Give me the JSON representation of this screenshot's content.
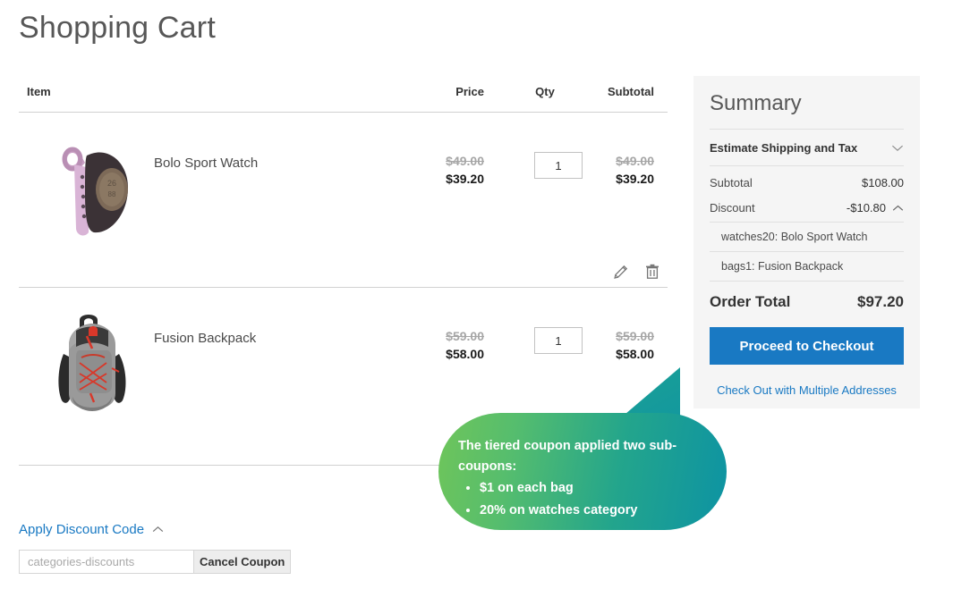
{
  "page": {
    "title": "Shopping Cart"
  },
  "cart": {
    "headers": {
      "item": "Item",
      "price": "Price",
      "qty": "Qty",
      "subtotal": "Subtotal"
    },
    "rows": [
      {
        "name": "Bolo Sport Watch",
        "image_alt": "bolo-sport-watch-image",
        "price_old": "$49.00",
        "price_new": "$39.20",
        "qty": "1",
        "subtotal_old": "$49.00",
        "subtotal_new": "$39.20",
        "edit_label": "edit-item",
        "remove_label": "remove-item"
      },
      {
        "name": "Fusion Backpack",
        "image_alt": "fusion-backpack-image",
        "price_old": "$59.00",
        "price_new": "$58.00",
        "qty": "1",
        "subtotal_old": "$59.00",
        "subtotal_new": "$58.00"
      }
    ]
  },
  "discount": {
    "toggle_label": "Apply Discount Code",
    "input_value": "",
    "input_placeholder": "categories-discounts",
    "button_label": "Cancel Coupon"
  },
  "summary": {
    "title": "Summary",
    "estimate_label": "Estimate Shipping and Tax",
    "subtotal_label": "Subtotal",
    "subtotal_value": "$108.00",
    "discount_label": "Discount",
    "discount_value": "-$10.80",
    "coupon_details": [
      "watches20: Bolo Sport Watch",
      "bags1: Fusion Backpack"
    ],
    "order_total_label": "Order Total",
    "order_total_value": "$97.20",
    "checkout_label": "Proceed to Checkout",
    "multi_address_label": "Check Out with Multiple Addresses"
  },
  "callout": {
    "heading": "The tiered coupon applied two sub-coupons:",
    "items": [
      "$1 on each bag",
      "20% on watches category"
    ]
  },
  "colors": {
    "accent_blue": "#1979c3",
    "panel_bg": "#f5f5f5",
    "callout_green": "#6fc55a",
    "callout_teal": "#0d93a3",
    "old_price_gray": "#a6a6a6"
  }
}
